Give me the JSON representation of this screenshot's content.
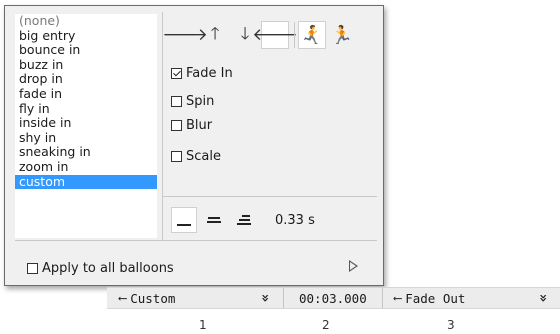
{
  "effects_list": [
    "(none)",
    "big entry",
    "bounce in",
    "buzz in",
    "drop in",
    "fade in",
    "fly in",
    "inside in",
    "shy in",
    "sneaking in",
    "zoom in",
    "custom"
  ],
  "selected_effect": "custom",
  "direction_buttons": {
    "right": "🡒",
    "up": "🡑",
    "down": "🡓",
    "left": "🡐",
    "run_in": "🏃",
    "run_out": "🏃"
  },
  "options": {
    "fade_in": "Fade In",
    "spin": "Spin",
    "blur": "Blur",
    "scale": "Scale"
  },
  "speed": {
    "value": "0.33 s"
  },
  "apply_all_label": "Apply to all balloons",
  "colors": {
    "selection": "#3399ff",
    "panel_bg": "#f0f0f0"
  },
  "timeline": {
    "in_effect": "Custom",
    "time": "00:03.000",
    "out_effect": "Fade Out",
    "column_numbers": [
      "1",
      "2",
      "3"
    ]
  }
}
